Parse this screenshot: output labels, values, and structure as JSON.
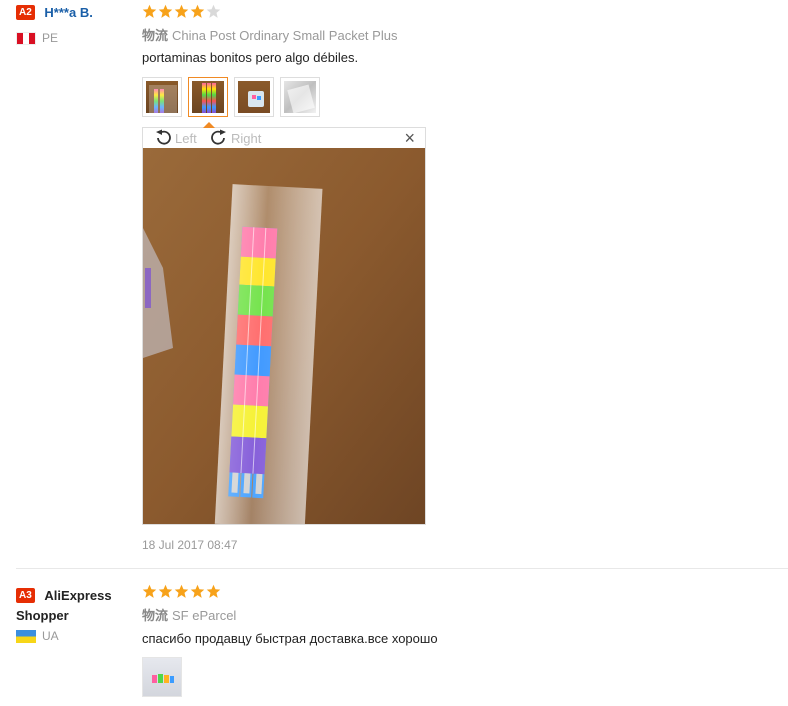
{
  "reviews": [
    {
      "badge": "A2",
      "name": "H***a B.",
      "country": "PE",
      "rating": 4,
      "shipping_prefix": "物流",
      "shipping": "China Post Ordinary Small Packet Plus",
      "text": "portaminas bonitos pero algo débiles.",
      "photos": [
        "pencils-photo-1",
        "pencils-photo-2",
        "pencils-photo-3",
        "pencils-photo-4"
      ],
      "viewer": {
        "rotate_left": "Left",
        "rotate_right": "Right",
        "close": "×"
      },
      "date": "18 Jul 2017 08:47"
    },
    {
      "badge": "A3",
      "name": "AliExpress Shopper",
      "country": "UA",
      "rating": 5,
      "shipping_prefix": "物流",
      "shipping": "SF eParcel",
      "text": "спасибо продавцу быстрая доставка.все хорошо",
      "photos": [
        "erasers-photo-1"
      ]
    }
  ],
  "colors": {
    "star": "#f7a21a",
    "star_empty": "#d9d9d9",
    "badge": "#e62e04",
    "active_thumb": "#f08a24"
  }
}
